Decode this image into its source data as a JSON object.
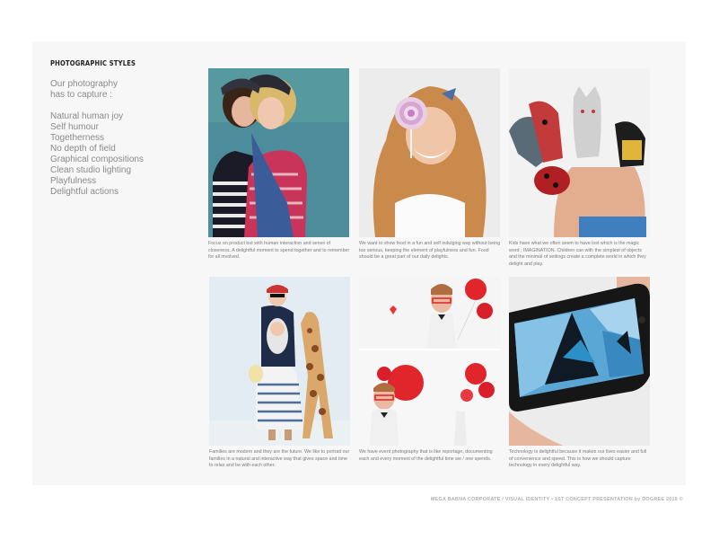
{
  "page": {
    "section_title": "PHOTOGRAPHIC STYLES",
    "intro_lines": [
      "Our photography",
      "has to capture :"
    ],
    "styles": [
      "Natural human joy",
      "Self humour",
      "Togetherness",
      "No depth of field",
      "Graphical compositions",
      "Clean studio lighting",
      "Playfulness",
      "Delightful actions"
    ],
    "footer": "MEGA BABNA CORPORATE / VISUAL IDENTITY • 1ST CONCEPT PRESENTATION by DOGREE 2016 ©"
  },
  "photos": [
    {
      "caption": "Focus on product but with human interaction and sense of closeness. A delightful moment to spend together and to remember for all involved."
    },
    {
      "caption": "We want to show food in a fun and self indulging way without being too serious, keeping the element of playfulness and fun. Food should be a great part of our daily delights."
    },
    {
      "caption": "Kids have what we often seem to have lost which is the magic word ; IMAGINATION. Children can with the simplest of objects and the minimal of settings create a complete world in which they delight and play."
    },
    {
      "caption": "Families are modern and they are the future. We like to portrait our families in a natural and interactive way that gives space and time to relax and be with each other."
    },
    {
      "caption": "We have event photography that is like reportage, documenting each and every moment of the delightful time we / one spends."
    },
    {
      "caption": "Technology is delightful because it makes our lives easier and full of convenience and speed. This is how we should capture technology in every delightful way."
    }
  ]
}
